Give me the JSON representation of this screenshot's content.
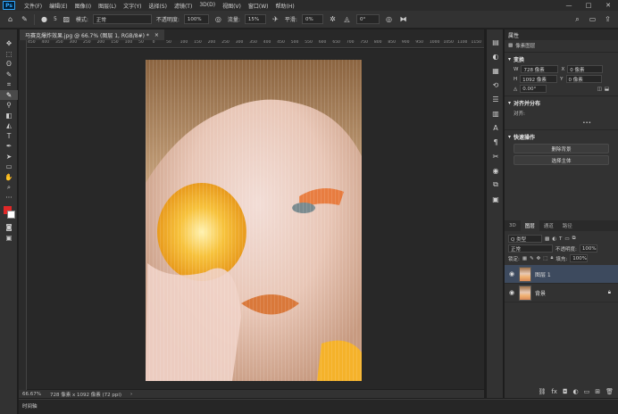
{
  "app": {
    "logo": "Ps"
  },
  "menu": [
    "文件(F)",
    "编辑(E)",
    "图像(I)",
    "图层(L)",
    "文字(Y)",
    "选择(S)",
    "滤镜(T)",
    "3D(D)",
    "视图(V)",
    "窗口(W)",
    "帮助(H)"
  ],
  "window_controls": {
    "minimize": "—",
    "maximize": "□",
    "close": "✕"
  },
  "options_bar": {
    "mode_label": "模式:",
    "mode_value": "正常",
    "opacity_label": "不透明度:",
    "opacity_value": "100%",
    "flow_label": "流量:",
    "flow_value": "15%",
    "smooth_label": "平滑:",
    "smooth_value": "0%",
    "angle_value": "0°",
    "brush_size": "5"
  },
  "document_tab": {
    "title": "马赛克爆炸效果.jpg @ 66.7% (图层 1, RGB/8#) *",
    "close": "×"
  },
  "ruler_ticks": [
    "450",
    "400",
    "350",
    "300",
    "250",
    "200",
    "150",
    "100",
    "50",
    "0",
    "50",
    "100",
    "150",
    "200",
    "250",
    "300",
    "350",
    "400",
    "450",
    "500",
    "550",
    "600",
    "650",
    "700",
    "750",
    "800",
    "850",
    "900",
    "950",
    "1000",
    "1050",
    "1100",
    "1150"
  ],
  "status": {
    "zoom": "66.67%",
    "doc_info": "728 像素 x 1092 像素 (72 ppi)"
  },
  "timeline": {
    "label": "时间轴"
  },
  "properties": {
    "title": "属性",
    "subtitle": "像素图层",
    "transform": {
      "header": "变换",
      "w_label": "W",
      "w_value": "728 像素",
      "x_label": "X",
      "x_value": "0 像素",
      "h_label": "H",
      "h_value": "1092 像素",
      "y_label": "Y",
      "y_value": "0 像素",
      "angle_value": "0.00°"
    },
    "align": {
      "header": "对齐并分布",
      "sub": "对齐:",
      "more": "•••"
    },
    "quick": {
      "header": "快速操作",
      "remove_bg": "删除背景",
      "select_subject": "选择主体"
    }
  },
  "layers_panel": {
    "tabs": [
      "3D",
      "图层",
      "通道",
      "路径"
    ],
    "active_tab": "图层",
    "filter_label": "Q 类型",
    "blend_mode": "正常",
    "opacity_label": "不透明度:",
    "opacity_value": "100%",
    "lock_label": "锁定:",
    "fill_label": "填充:",
    "fill_value": "100%",
    "layers": [
      {
        "name": "图层 1",
        "selected": true,
        "locked": false
      },
      {
        "name": "背景",
        "selected": false,
        "locked": true
      }
    ],
    "bottom_icons": [
      "link-icon",
      "fx-icon",
      "mask-icon",
      "adjustment-icon",
      "group-icon",
      "new-layer-icon",
      "trash-icon"
    ]
  },
  "colors": {
    "foreground": "#e02828",
    "background": "#ffffff",
    "selected_layer": "#3d4a5e"
  }
}
